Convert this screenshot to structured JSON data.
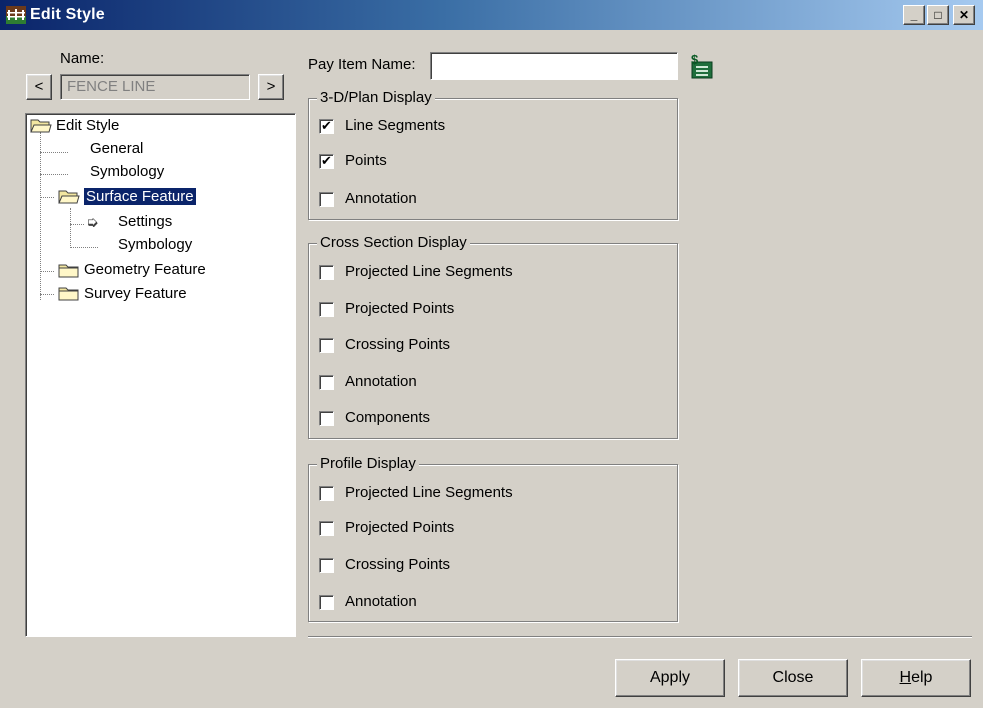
{
  "window": {
    "title": "Edit Style",
    "minimize_glyph": "_",
    "maximize_glyph": "□",
    "close_glyph": "✕",
    "icon": "edit-style-app-icon"
  },
  "name_panel": {
    "label": "Name:",
    "value": "FENCE LINE",
    "prev_glyph": "<",
    "next_glyph": ">"
  },
  "tree": {
    "root": "Edit Style",
    "items": [
      {
        "label": "General",
        "level": 1
      },
      {
        "label": "Symbology",
        "level": 1
      },
      {
        "label": "Surface Feature",
        "level": 1,
        "selected": true
      },
      {
        "label": "Settings",
        "level": 2,
        "arrow": true
      },
      {
        "label": "Symbology",
        "level": 2
      },
      {
        "label": "Geometry Feature",
        "level": 1
      },
      {
        "label": "Survey Feature",
        "level": 1
      }
    ],
    "arrow_glyph": "➭"
  },
  "pay_item": {
    "label": "Pay Item Name:",
    "value": "",
    "icon": "pay-item-lookup-icon"
  },
  "plan_display": {
    "title": "3-D/Plan Display",
    "options": [
      {
        "label": "Line Segments",
        "checked": true
      },
      {
        "label": "Points",
        "checked": true
      },
      {
        "label": "Annotation",
        "checked": false
      }
    ]
  },
  "cross_section_display": {
    "title": "Cross Section Display",
    "options": [
      {
        "label": "Projected Line Segments",
        "checked": false
      },
      {
        "label": "Projected Points",
        "checked": false
      },
      {
        "label": "Crossing Points",
        "checked": false
      },
      {
        "label": "Annotation",
        "checked": false
      },
      {
        "label": "Components",
        "checked": false
      }
    ]
  },
  "profile_display": {
    "title": "Profile Display",
    "options": [
      {
        "label": "Projected Line Segments",
        "checked": false
      },
      {
        "label": "Projected Points",
        "checked": false
      },
      {
        "label": "Crossing Points",
        "checked": false
      },
      {
        "label": "Annotation",
        "checked": false
      }
    ]
  },
  "buttons": {
    "apply": "Apply",
    "close": "Close",
    "help_mnemonic": "H",
    "help_rest": "elp"
  },
  "check_glyph": "✔"
}
